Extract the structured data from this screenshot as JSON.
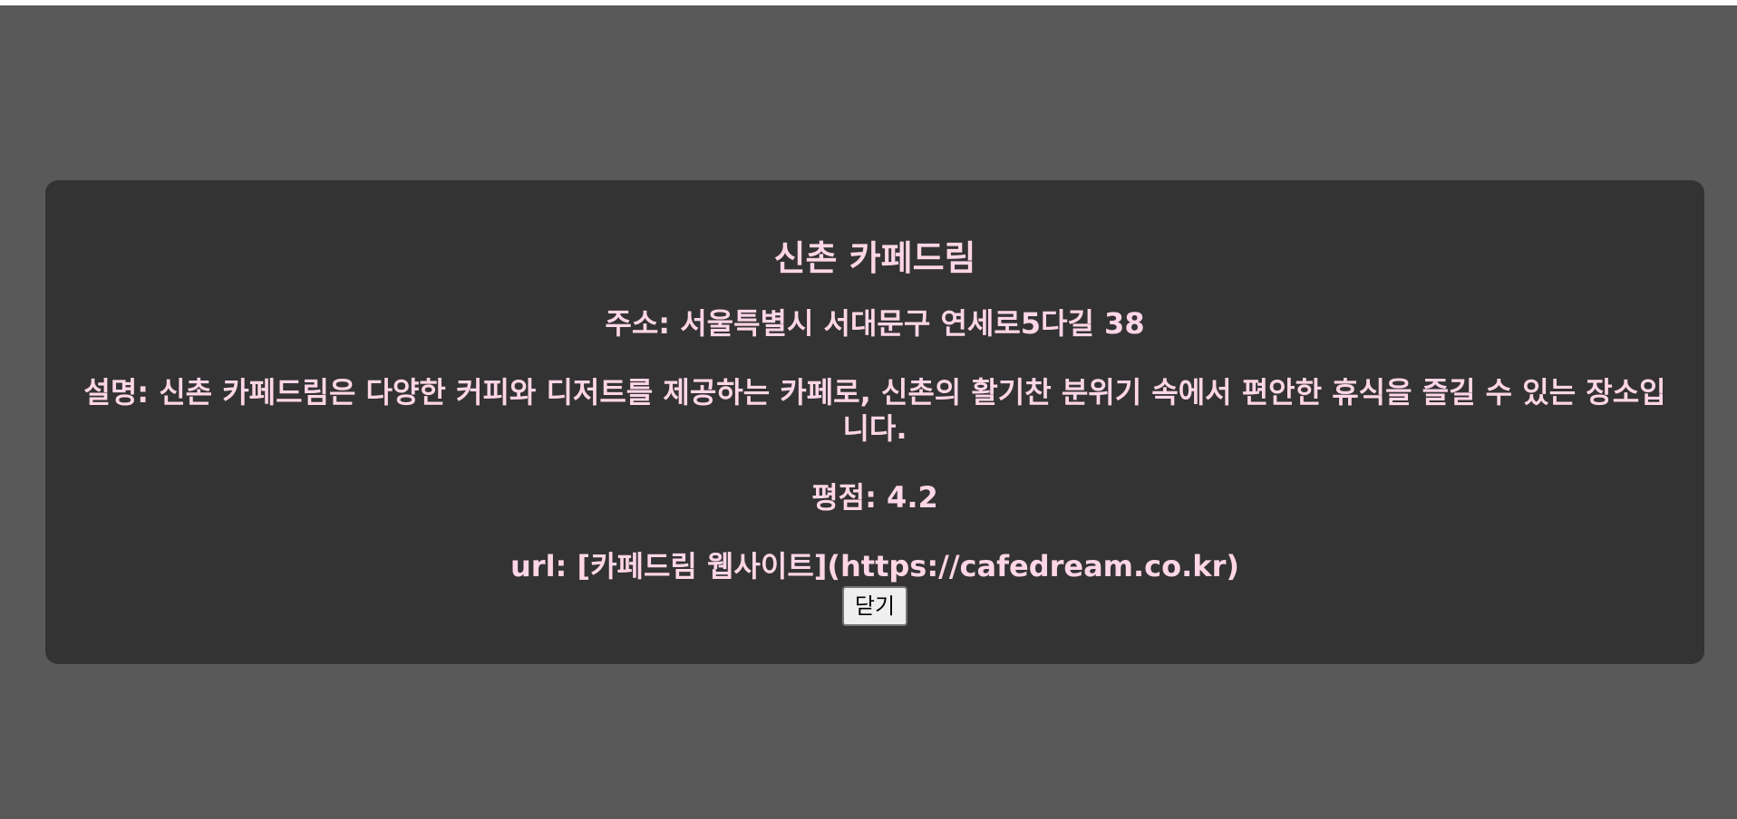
{
  "modal": {
    "title": "신촌 카페드림",
    "address": "주소: 서울특별시 서대문구 연세로5다길 38",
    "description": "설명: 신촌 카페드림은 다양한 커피와 디저트를 제공하는 카페로, 신촌의 활기찬 분위기 속에서 편안한 휴식을 즐길 수 있는 장소입니다.",
    "rating": "평점: 4.2",
    "url": "url: [카페드림 웹사이트](https://cafedream.co.kr)",
    "close_label": "닫기"
  },
  "colors": {
    "overlay": "#595959",
    "modal_bg": "#333333",
    "text": "#ffd6e6"
  }
}
